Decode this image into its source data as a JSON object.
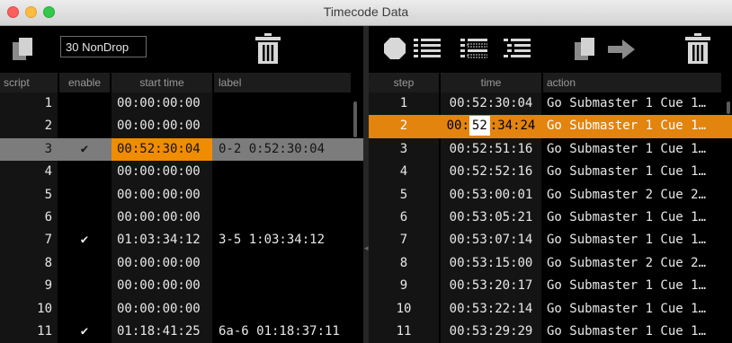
{
  "window": {
    "title": "Timecode Data"
  },
  "left": {
    "format": "30 NonDrop",
    "columns": {
      "script": "script",
      "enable": "enable",
      "start": "start time",
      "label": "label"
    },
    "rows": [
      {
        "script": "1",
        "enable": "",
        "start": "00:00:00:00",
        "label": ""
      },
      {
        "script": "2",
        "enable": "",
        "start": "00:00:00:00",
        "label": ""
      },
      {
        "script": "3",
        "enable": "✔",
        "start": "00:52:30:04",
        "label": "0-2 0:52:30:04"
      },
      {
        "script": "4",
        "enable": "",
        "start": "00:00:00:00",
        "label": ""
      },
      {
        "script": "5",
        "enable": "",
        "start": "00:00:00:00",
        "label": ""
      },
      {
        "script": "6",
        "enable": "",
        "start": "00:00:00:00",
        "label": ""
      },
      {
        "script": "7",
        "enable": "✔",
        "start": "01:03:34:12",
        "label": "3-5 1:03:34:12"
      },
      {
        "script": "8",
        "enable": "",
        "start": "00:00:00:00",
        "label": ""
      },
      {
        "script": "9",
        "enable": "",
        "start": "00:00:00:00",
        "label": ""
      },
      {
        "script": "10",
        "enable": "",
        "start": "00:00:00:00",
        "label": ""
      },
      {
        "script": "11",
        "enable": "✔",
        "start": "01:18:41:25",
        "label": "6a-6 01:18:37:11"
      }
    ]
  },
  "right": {
    "columns": {
      "step": "step",
      "time": "time",
      "action": "action"
    },
    "selected_time_parts": {
      "before": "00:",
      "editing": "52",
      "after": ":34:24"
    },
    "rows": [
      {
        "step": "1",
        "time": "00:52:30:04",
        "action": "Go Submaster 1 Cue 1…"
      },
      {
        "step": "2",
        "time": "00:52:34:24",
        "action": "Go Submaster 1 Cue 1…"
      },
      {
        "step": "3",
        "time": "00:52:51:16",
        "action": "Go Submaster 1 Cue 1…"
      },
      {
        "step": "4",
        "time": "00:52:52:16",
        "action": "Go Submaster 1 Cue 1…"
      },
      {
        "step": "5",
        "time": "00:53:00:01",
        "action": "Go Submaster 2 Cue 2…"
      },
      {
        "step": "6",
        "time": "00:53:05:21",
        "action": "Go Submaster 1 Cue 1…"
      },
      {
        "step": "7",
        "time": "00:53:07:14",
        "action": "Go Submaster 1 Cue 1…"
      },
      {
        "step": "8",
        "time": "00:53:15:00",
        "action": "Go Submaster 2 Cue 2…"
      },
      {
        "step": "9",
        "time": "00:53:20:17",
        "action": "Go Submaster 1 Cue 1…"
      },
      {
        "step": "10",
        "time": "00:53:22:14",
        "action": "Go Submaster 1 Cue 1…"
      },
      {
        "step": "11",
        "time": "00:53:29:29",
        "action": "Go Submaster 1 Cue 1…"
      }
    ]
  },
  "colors": {
    "highlight": "#f08c00",
    "selected_row_right": "#e2840e",
    "selected_row_left": "#7c7c7c"
  },
  "icons": {
    "left_toolbar": [
      "copy-icon",
      "trash-icon"
    ],
    "right_toolbar": [
      "record-icon",
      "list-icon",
      "list-dotted-icon",
      "list-indent-icon",
      "copy-icon",
      "arrow-right-icon",
      "trash-icon"
    ]
  }
}
